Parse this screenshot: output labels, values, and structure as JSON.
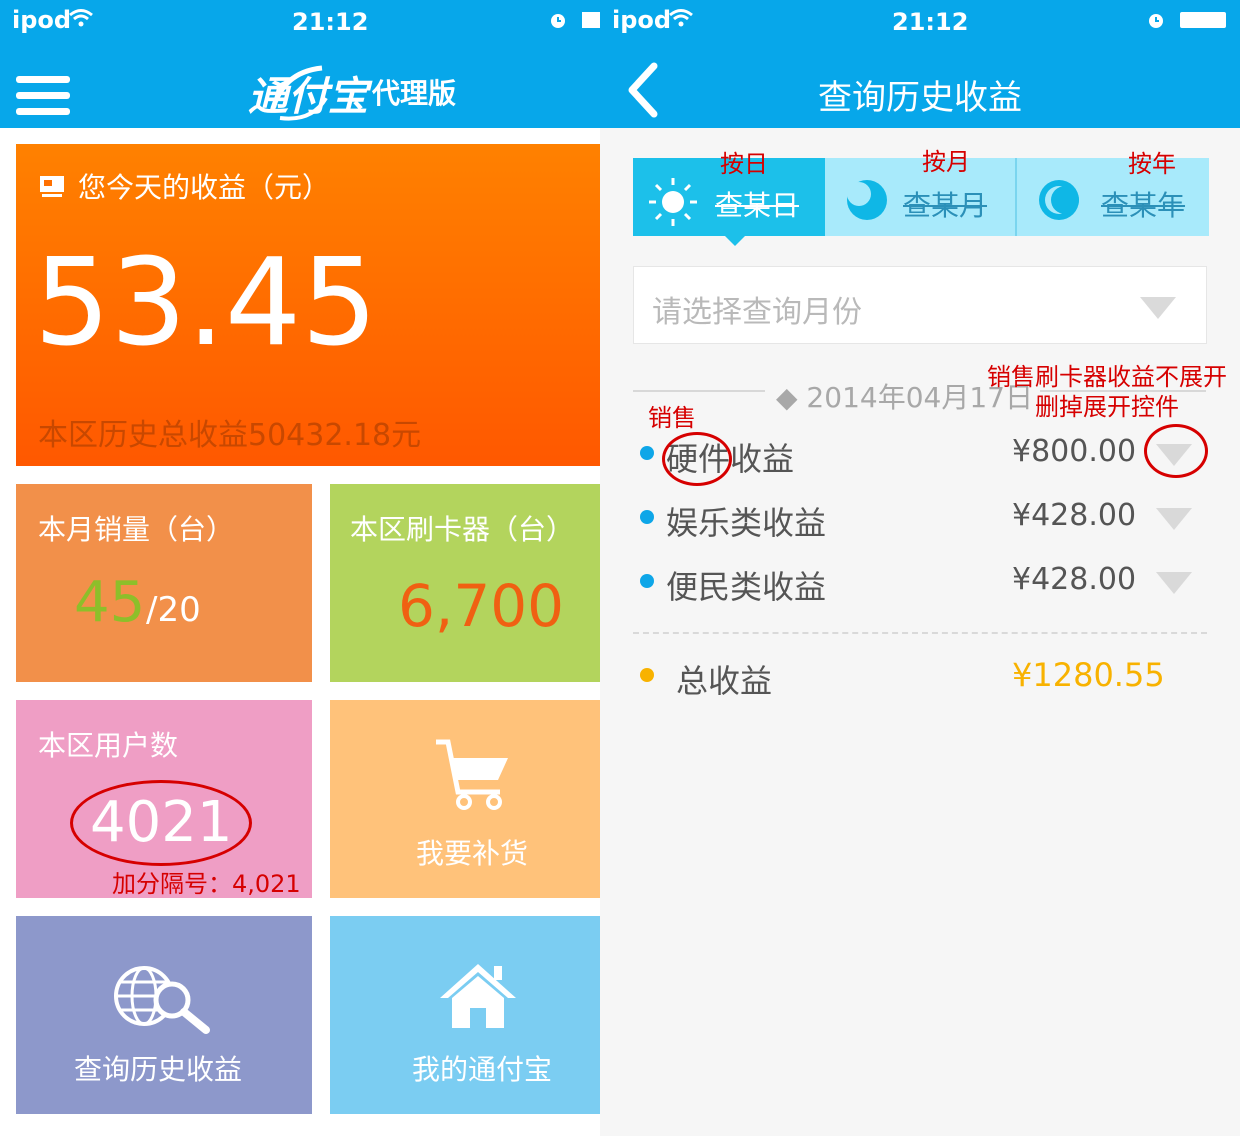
{
  "left": {
    "status_bar": {
      "carrier": "ipod",
      "time": "21:12"
    },
    "header": {
      "logo_main": "通付宝",
      "logo_sub": "代理版"
    },
    "today": {
      "title": "您今天的收益（元）",
      "amount": "53.45",
      "history_total": "本区历史总收益50432.18元"
    },
    "monthly_sales": {
      "title": "本月销量（台）",
      "value": "45",
      "target": "/20"
    },
    "card_readers": {
      "title": "本区刷卡器（台）",
      "value": "6,700"
    },
    "users": {
      "title": "本区用户数",
      "value": "4021"
    },
    "restock": {
      "label": "我要补货"
    },
    "history_query": {
      "label": "查询历史收益"
    },
    "my_account": {
      "label": "我的通付宝"
    },
    "annotation_users": "加分隔号：4,021"
  },
  "right": {
    "status_bar": {
      "carrier": "ipod",
      "time": "21:12"
    },
    "header": {
      "title": "查询历史收益"
    },
    "segments": [
      {
        "label": "查某日",
        "annotation": "按日",
        "active": true
      },
      {
        "label": "查某月",
        "annotation": "按月",
        "active": false
      },
      {
        "label": "查某年",
        "annotation": "按年",
        "active": false
      }
    ],
    "month_select": {
      "placeholder": "请选择查询月份"
    },
    "date": "◆ 2014年04月17日",
    "rows": [
      {
        "label": "硬件收益",
        "amount": "¥800.00"
      },
      {
        "label": "娱乐类收益",
        "amount": "¥428.00"
      },
      {
        "label": "便民类收益",
        "amount": "¥428.00"
      }
    ],
    "total": {
      "label": "总收益",
      "amount": "¥1280.55"
    },
    "annotation_sales": "销售",
    "annotation_right": "销售刷卡器收益不展开\n删掉展开控件"
  },
  "colors": {
    "blue": "#07a7ea",
    "orange": "#ff6c00",
    "tile_orange": "#f2904a",
    "tile_green": "#b3d45d",
    "tile_pink": "#ef9ec5",
    "tile_peach": "#ffc27a",
    "tile_purple": "#8d98cb",
    "tile_skyblue": "#7bcdf2",
    "annotation_red": "#d60000"
  },
  "icons": [
    "wifi-icon",
    "alarm-icon",
    "battery-icon",
    "menu-icon",
    "back-icon",
    "sun-icon",
    "moon-icon",
    "cart-icon",
    "globe-search-icon",
    "house-icon",
    "dropdown-icon"
  ]
}
